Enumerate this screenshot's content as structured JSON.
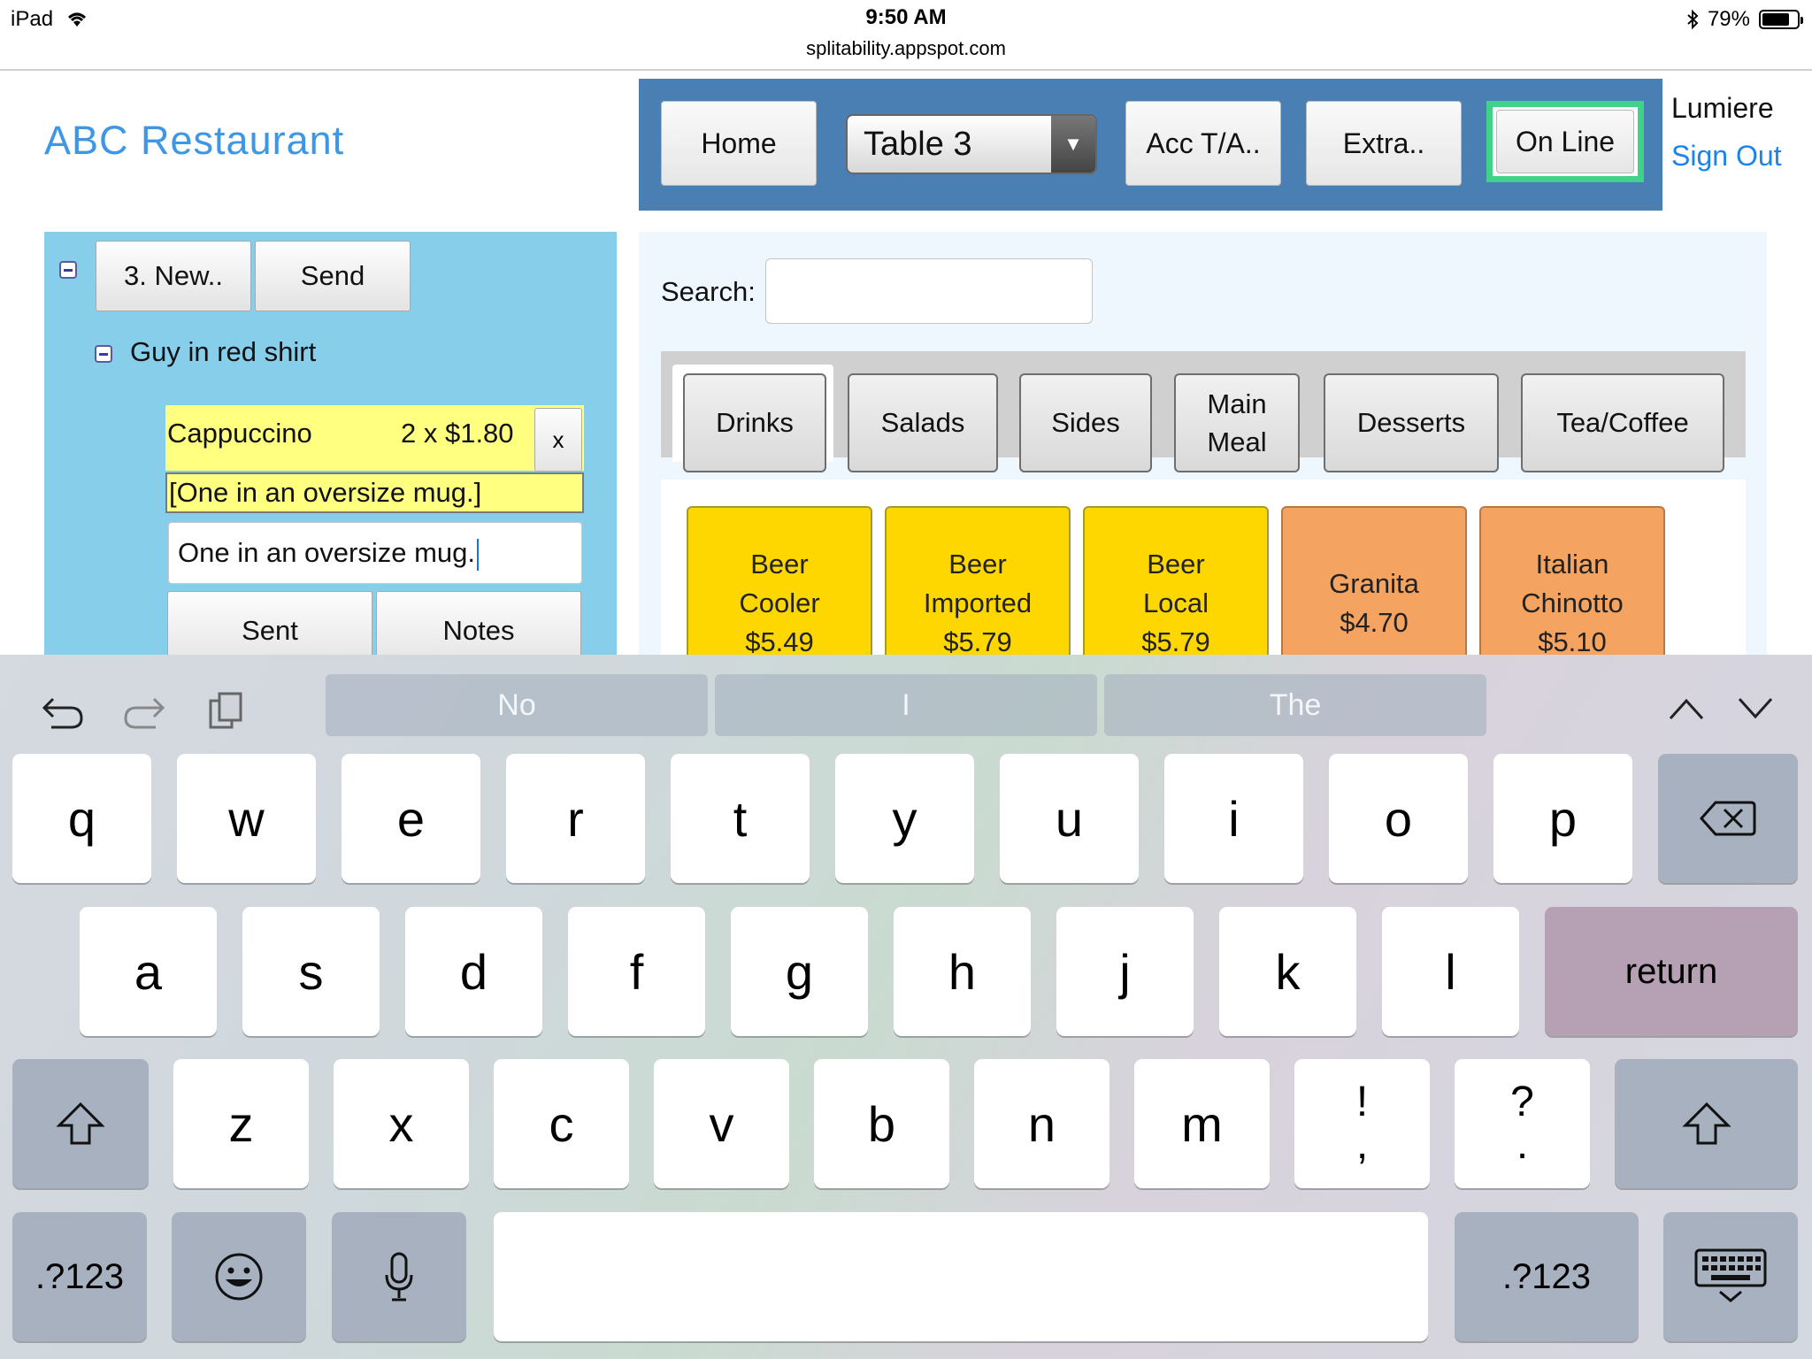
{
  "status_bar": {
    "device": "iPad",
    "time": "9:50 AM",
    "url": "splitability.appspot.com",
    "battery": "79%",
    "battery_level": 0.79
  },
  "header": {
    "brand": "ABC Restaurant",
    "nav": {
      "home": "Home",
      "table_select": "Table 3",
      "acc": "Acc T/A..",
      "extra": "Extra..",
      "online": "On Line"
    },
    "user": "Lumiere",
    "sign_out": "Sign Out"
  },
  "order_panel": {
    "new_btn": "3. New..",
    "send_btn": "Send",
    "guest": "Guy in red shirt",
    "item": {
      "name": "Cappuccino",
      "qty_price": "2 x $1.80",
      "remove": "x"
    },
    "note_display": "[One in an oversize mug.]",
    "note_input": "One in an oversize mug.",
    "sent_btn": "Sent",
    "notes_btn": "Notes"
  },
  "menu_panel": {
    "search_label": "Search:",
    "search_value": "",
    "tabs": [
      "Drinks",
      "Salads",
      "Sides",
      "Main Meal",
      "Desserts",
      "Tea/Coffee"
    ],
    "active_tab": "Drinks",
    "items": [
      {
        "line1": "Beer",
        "line2": "Cooler",
        "price": "$5.49",
        "color": "#ffd700"
      },
      {
        "line1": "Beer",
        "line2": "Imported",
        "price": "$5.79",
        "color": "#ffd700"
      },
      {
        "line1": "Beer",
        "line2": "Local",
        "price": "$5.79",
        "color": "#ffd700"
      },
      {
        "line1": "Granita",
        "line2": "$4.70",
        "price": "",
        "color": "#f4a460"
      },
      {
        "line1": "Italian",
        "line2": "Chinotto",
        "price": "$5.10",
        "color": "#f4a460"
      }
    ]
  },
  "keyboard": {
    "suggestions": [
      "No",
      "I",
      "The"
    ],
    "row1": [
      "q",
      "w",
      "e",
      "r",
      "t",
      "y",
      "u",
      "i",
      "o",
      "p"
    ],
    "row2": [
      "a",
      "s",
      "d",
      "f",
      "g",
      "h",
      "j",
      "k",
      "l"
    ],
    "row3": [
      "z",
      "x",
      "c",
      "v",
      "b",
      "n",
      "m"
    ],
    "punct1": {
      "top": "!",
      "bottom": ","
    },
    "punct2": {
      "top": "?",
      "bottom": "."
    },
    "return": "return",
    "numbers": ".?123",
    "icons": {
      "undo": "undo-icon",
      "redo": "redo-icon",
      "paste": "paste-icon",
      "backspace": "backspace-icon",
      "shift": "shift-icon",
      "emoji": "emoji-icon",
      "mic": "microphone-icon",
      "hide": "keyboard-hide-icon"
    }
  }
}
